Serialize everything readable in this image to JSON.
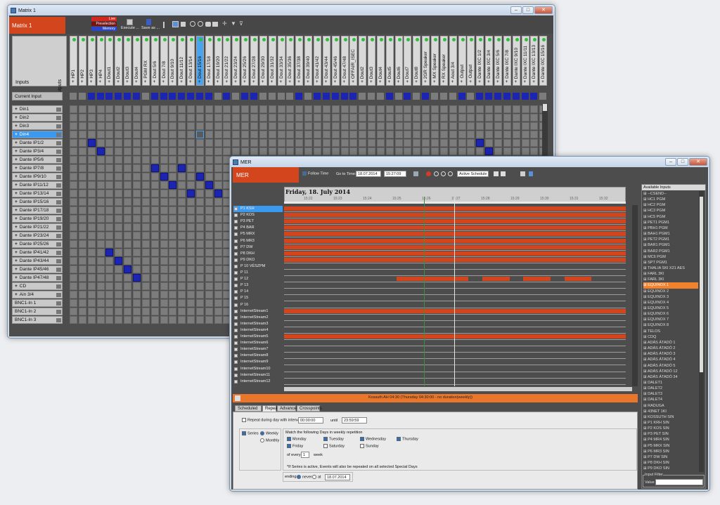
{
  "matrix": {
    "window_title": "Matrix 1",
    "app_name": "Matrix 1",
    "live_label": "Live",
    "preselection_label": "Preselection",
    "memory_label": "Memory",
    "execute_label": "Execute ...",
    "save_as_label": "Save as ...",
    "outputs_label": "Outputs",
    "inputs_label": "Inputs",
    "current_input_label": "Current Input",
    "columns": [
      "HP1",
      "HP2",
      "HP3",
      "HP4",
      "Dout1",
      "Dout2",
      "Dout3",
      "Dout4",
      "PGM RX",
      "Dout 5/6",
      "Dout 7/8",
      "Dout 9/10",
      "Dout 11/12",
      "Dout 13/14",
      "Dout 15/16",
      "Dout 17/18",
      "Dout 19/20",
      "Dout 21/22",
      "Dout 23/24",
      "Dout 25/26",
      "Dout 27/28",
      "Dout 29/30",
      "Dout 31/32",
      "Dout 33/34",
      "Dout 35/36",
      "Dout 37/38",
      "Dout 39/40",
      "Dout 41/42",
      "Dout 43/44",
      "Dout 45/46",
      "Dout 47/48",
      "OFFAIR_ISEC",
      "Dout2",
      "Dout3",
      "Dout4",
      "Dout5",
      "Dout6",
      "Dout7",
      "Dout8",
      "2GR Speaker",
      "MX Speaker",
      "RX Speaker",
      "Aout 3/4",
      "Output",
      "Output",
      "Dante IXC 1/2",
      "Dante IXC 3/4",
      "Dante IXC 5/6",
      "Dante IXC 7/8",
      "Dante IXC 9/10",
      "Dante IXC 11/11",
      "Dante IXC 13/13",
      "Dante IXC 15/16"
    ],
    "rows": [
      {
        "label": "Din1",
        "plus": true
      },
      {
        "label": "Din2",
        "plus": true
      },
      {
        "label": "Din3",
        "plus": true
      },
      {
        "label": "Din4",
        "plus": true
      },
      {
        "label": "Dante IP1/2",
        "plus": true
      },
      {
        "label": "Dante IP3/4",
        "plus": true
      },
      {
        "label": "Dante IP5/6",
        "plus": true
      },
      {
        "label": "Dante IP7/8",
        "plus": true
      },
      {
        "label": "Dante IP9/10",
        "plus": true
      },
      {
        "label": "Dante IP11/12",
        "plus": true
      },
      {
        "label": "Dante IP13/14",
        "plus": true
      },
      {
        "label": "Dante IP15/16",
        "plus": true
      },
      {
        "label": "Dante IP17/18",
        "plus": true
      },
      {
        "label": "Dante IP19/20",
        "plus": true
      },
      {
        "label": "Dante IP21/22",
        "plus": true
      },
      {
        "label": "Dante IP23/24",
        "plus": true
      },
      {
        "label": "Dante IP25/26",
        "plus": true
      },
      {
        "label": "Dante IP41/42",
        "plus": true
      },
      {
        "label": "Dante IP43/44",
        "plus": true
      },
      {
        "label": "Dante IP45/46",
        "plus": true
      },
      {
        "label": "Dante IP47/48",
        "plus": true
      },
      {
        "label": "CD",
        "plus": true
      },
      {
        "label": "Ain 3/4",
        "plus": true
      },
      {
        "label": "BNC1-In 1",
        "plus": false
      },
      {
        "label": "BNC1-In 2",
        "plus": false
      },
      {
        "label": "BNC1-In 3",
        "plus": false
      }
    ],
    "current_input_on": [
      2,
      3,
      4,
      5,
      6,
      7,
      9,
      10,
      11,
      12,
      13,
      14,
      15,
      17,
      19,
      20,
      25,
      27,
      28,
      29,
      30,
      31,
      35,
      37,
      39,
      43,
      45,
      46,
      47,
      48,
      49,
      50,
      51
    ],
    "crosspoints": [
      [
        4,
        2
      ],
      [
        5,
        3
      ],
      [
        7,
        9
      ],
      [
        7,
        12
      ],
      [
        8,
        10
      ],
      [
        8,
        14
      ],
      [
        9,
        11
      ],
      [
        9,
        15
      ],
      [
        10,
        13
      ],
      [
        10,
        16
      ],
      [
        17,
        4
      ],
      [
        18,
        5
      ],
      [
        19,
        6
      ],
      [
        20,
        7
      ],
      [
        4,
        45
      ],
      [
        5,
        46
      ]
    ],
    "selected": {
      "row": 3,
      "col": 14
    }
  },
  "mer": {
    "window_title": "MER",
    "app_name": "MER",
    "follow_time_label": "Follow Time",
    "go_to_time_label": "Go to Time:",
    "date_value": "18.07.2014",
    "time_value": "15:27:09",
    "schedule_value": "Active Schedule",
    "day_header": "Friday, 18. July 2014",
    "ticks": [
      "15:22",
      "15:23",
      "15:24",
      "15:25",
      "15:26",
      "15:27",
      "15:28",
      "15:29",
      "15:30",
      "15:31",
      "15:32"
    ],
    "tracks": [
      "P1 KSH",
      "P2 KOS",
      "P3 PET",
      "P4 BAR",
      "P5 MRX",
      "P6 MR3",
      "P7 DW",
      "P8 DKH",
      "P9 DKO",
      "P 10 VÉSZPM",
      "P 11",
      "P 12",
      "P 13",
      "P 14",
      "P 15",
      "P 16",
      "InternetStream1",
      "InternetStream2",
      "InternetStream3",
      "InternetStream4",
      "InternetStream5",
      "InternetStream6",
      "InternetStream7",
      "InternetStream8",
      "InternetStream9",
      "InternetStream10",
      "InternetStream11",
      "InternetStream12"
    ],
    "selected_track": 0,
    "full_bar_tracks": [
      0,
      1,
      2,
      3,
      4,
      5,
      6,
      7,
      8,
      16,
      20
    ],
    "partial_bars": [
      {
        "track": 11,
        "segments": [
          [
            0.33,
            0.47
          ],
          [
            0.46,
            0.54
          ],
          [
            0.58,
            0.66
          ],
          [
            0.7,
            0.78
          ],
          [
            0.82,
            0.9
          ]
        ]
      }
    ],
    "status_text": "Kossuth AH 04:30 (Thursday 04:30:00 - no duration(weekly))",
    "tabs": [
      "Scheduled Task",
      "Repeat",
      "Advanced",
      "Crosspoints"
    ],
    "active_tab": 1,
    "repeat": {
      "repeat_interval_label": "Repeat during day with interval",
      "interval_value": "00:00:00",
      "until_label": "until",
      "until_value": "23:59:59",
      "series_label": "Series",
      "weekly_label": "Weekly",
      "monthly_label": "Monthly",
      "match_label": "Match the following Days in weekly repetition",
      "days": [
        {
          "name": "Monday",
          "on": true
        },
        {
          "name": "Tuesday",
          "on": true
        },
        {
          "name": "Wednesday",
          "on": true
        },
        {
          "name": "Thursday",
          "on": true
        },
        {
          "name": "Friday",
          "on": true
        },
        {
          "name": "Saturday",
          "on": false
        },
        {
          "name": "Sunday",
          "on": false
        }
      ],
      "of_every_label": "of every",
      "every_value": "1",
      "week_label": "week",
      "note": "*If Series is active, Events will also be repeated on all selected Special Days",
      "ending_label": "ending",
      "never_label": "never",
      "at_label": "at",
      "ending_date": "18.07.2014"
    },
    "available_inputs_label": "Available Inputs",
    "available_inputs": [
      "--CSEND--",
      "HC1 PGM",
      "HC2 PGM",
      "HC3 PGM",
      "HC5 PGM",
      "PET1 PGM1",
      "PBH1 PGM",
      "BAH1 PGM1",
      "PET2 PGM1",
      "BAR1 PGM1",
      "BAR2 PGM1",
      "MC6 PGM",
      "SPT PGM1",
      "THALIA SKI X21 AES",
      "FARL 3KI",
      "FARL 3KI",
      "EQUINOX 1",
      "EQUINOX 2",
      "EQUINOX 3",
      "EQUINOX 4",
      "EQUINOX 5",
      "EQUINOX 6",
      "EQUINOX 7",
      "EQUINOX 8",
      "TELOS",
      "CDQ",
      "ADÁS ÁTADÓ 1",
      "ADÁS ÁTADÓ 2",
      "ADÁS ÁTADÓ 3",
      "ADÁS ÁTADÓ 4",
      "ADÁS ÁTADÓ 5",
      "ADÁS ÁTADÓ 12",
      "ADÁS ÁTADÓ 34",
      "DALET1",
      "DALET2",
      "DALET3",
      "DALET4",
      "RADUGA",
      "43NET 1KI",
      "KOSSUTH SIN",
      "P1 KRH SIN",
      "P2 KOS SIN",
      "P3 PET SIN",
      "P4 MR4 SIN",
      "P5 MRX SIN",
      "P6 MR3 SIN",
      "P7 DW SIN",
      "P8 DKH SIN",
      "P9 DKO SIN"
    ],
    "available_selected": 16,
    "input_filter_label": "Input Filter",
    "value_label": "Value"
  }
}
